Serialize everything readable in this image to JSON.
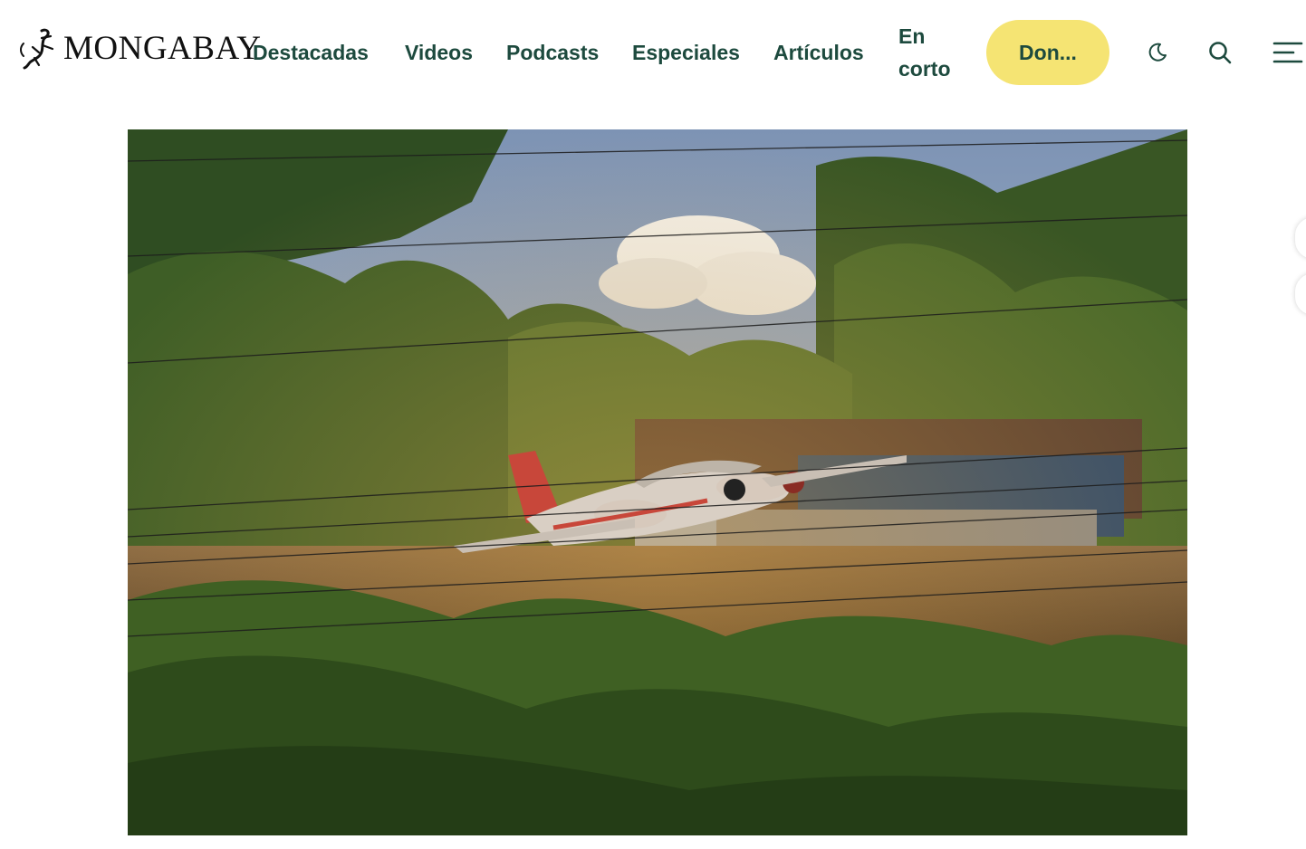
{
  "brand": {
    "name": "MONGABAY"
  },
  "nav": {
    "items": [
      {
        "label": "Destacadas"
      },
      {
        "label": "Videos"
      },
      {
        "label": "Podcasts"
      },
      {
        "label": "Especiales"
      },
      {
        "label": "Artículos"
      },
      {
        "label": "En corto"
      }
    ],
    "donate_label": "Don..."
  },
  "icons": {
    "theme": "moon-icon",
    "search": "search-icon",
    "menu": "menu-icon"
  },
  "colors": {
    "nav_text": "#1d4a3e",
    "donate_bg": "#f5e473"
  }
}
